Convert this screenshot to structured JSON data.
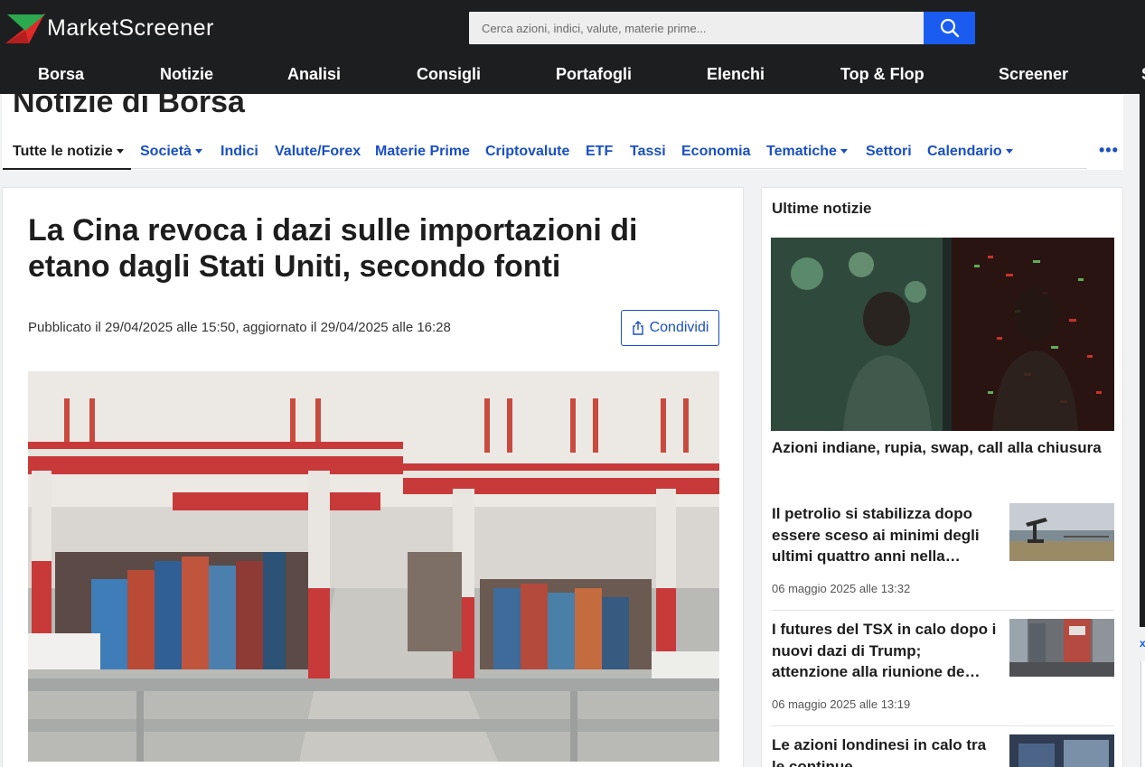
{
  "header": {
    "logo_text": "MarketScreener",
    "search_placeholder": "Cerca azioni, indici, valute, materie prime...",
    "brand_colors": {
      "green": "#2ca84f",
      "red": "#e02a2a",
      "blue": "#1a5cf0"
    }
  },
  "main_nav": [
    "Borsa",
    "Notizie",
    "Analisi",
    "Consigli",
    "Portafogli",
    "Elenchi",
    "Top & Flop",
    "Screener",
    "S"
  ],
  "section": {
    "title": "Notizie di Borsa",
    "tabs": [
      {
        "label": "Tutte le notizie",
        "dropdown": true,
        "active": true
      },
      {
        "label": "Società",
        "dropdown": true
      },
      {
        "label": "Indici"
      },
      {
        "label": "Valute/Forex"
      },
      {
        "label": "Materie Prime"
      },
      {
        "label": "Criptovalute"
      },
      {
        "label": "ETF"
      },
      {
        "label": "Tassi"
      },
      {
        "label": "Economia"
      },
      {
        "label": "Tematiche",
        "dropdown": true
      },
      {
        "label": "Settori"
      },
      {
        "label": "Calendario",
        "dropdown": true
      }
    ],
    "more": "•••"
  },
  "article": {
    "title": "La Cina revoca i dazi sulle importazioni di etano dagli Stati Uniti, secondo fonti",
    "published": "Pubblicato il 29/04/2025 alle 15:50, aggiornato il 29/04/2025 alle 16:28",
    "share_label": "Condividi",
    "image_label": "container port cranes"
  },
  "sidebar": {
    "title": "Ultime notizie",
    "featured": {
      "headline": "Azioni indiane, rupia, swap, call alla chiusura"
    },
    "items": [
      {
        "headline": "Il petrolio si stabilizza dopo essere sceso ai minimi degli ultimi quattro anni nella…",
        "time": "06 maggio 2025 alle 13:32"
      },
      {
        "headline": "I futures del TSX in calo dopo i nuovi dazi di Trump; attenzione alla riunione de…",
        "time": "06 maggio 2025 alle 13:19"
      },
      {
        "headline": "Le azioni londinesi in calo tra le continue…",
        "time": ""
      }
    ]
  },
  "edge": {
    "close_glyph": "x"
  }
}
